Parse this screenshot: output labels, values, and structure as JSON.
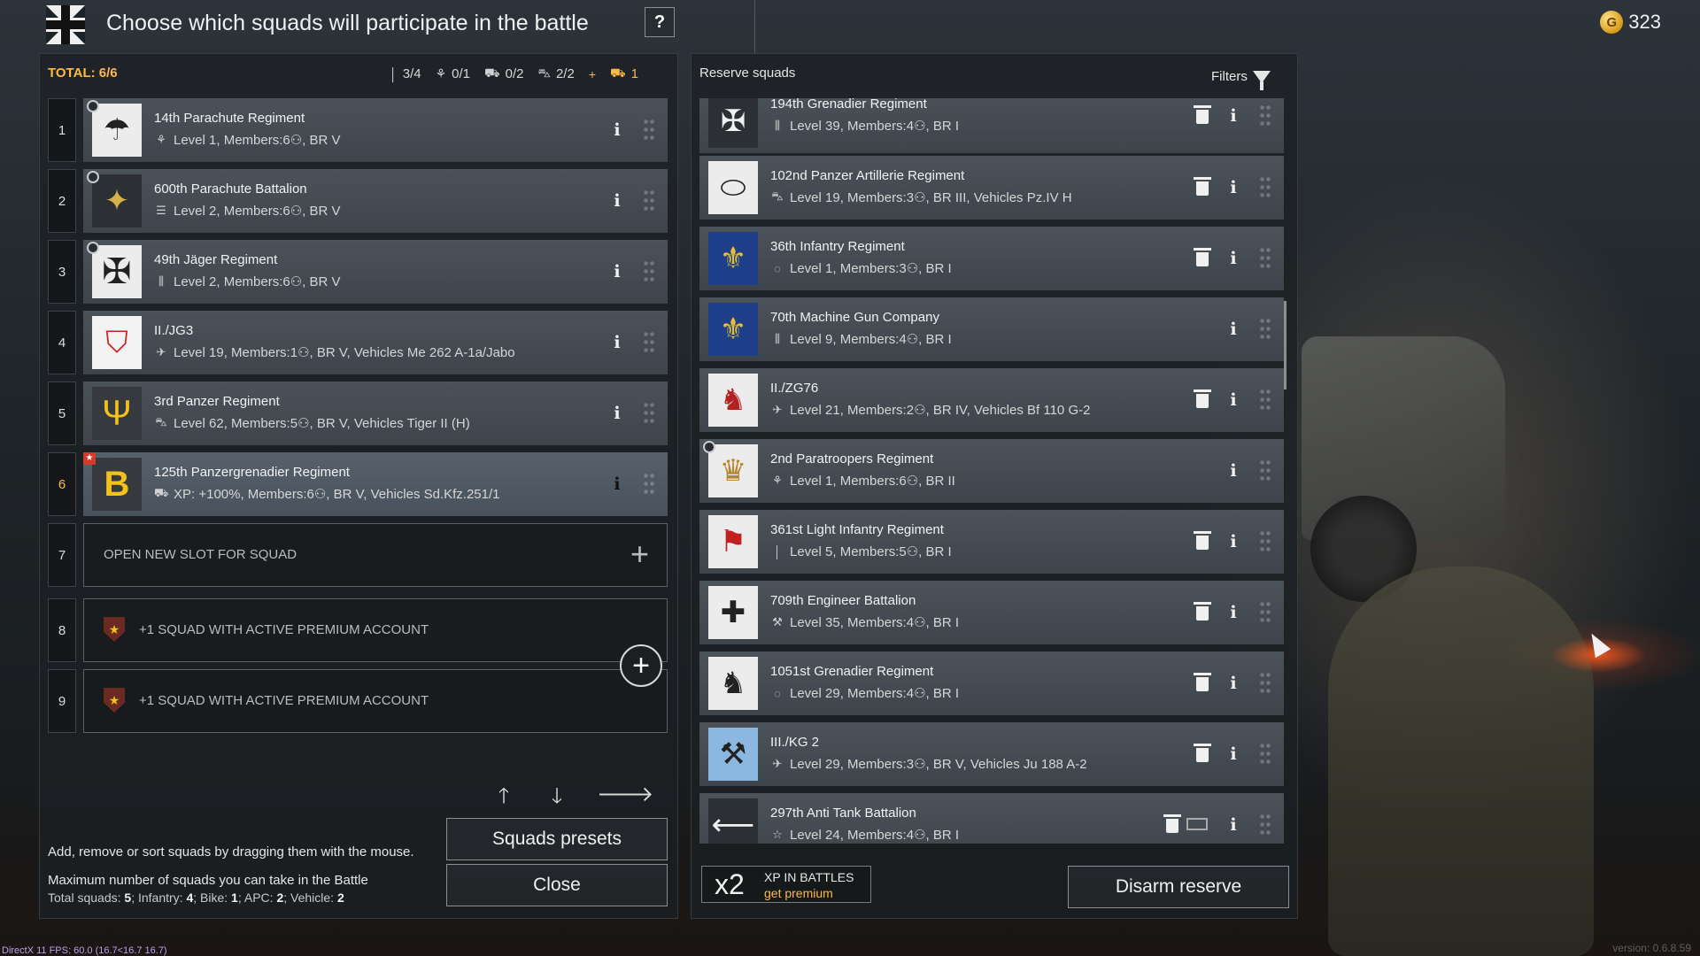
{
  "header": {
    "title": "Choose which squads will participate in the battle",
    "help_label": "?",
    "gold_symbol": "G",
    "gold_amount": "323"
  },
  "lineup": {
    "total_label": "TOTAL: 6/6",
    "counters": [
      {
        "icon": "infantry-icon",
        "glyph": "│",
        "value": "3/4"
      },
      {
        "icon": "paratrooper-icon",
        "glyph": "⚘",
        "value": "0/1"
      },
      {
        "icon": "vehicle-icon",
        "glyph": "⛟",
        "value": "0/2"
      },
      {
        "icon": "tank-icon",
        "glyph": "⛍",
        "value": "2/2"
      },
      {
        "icon": "plus-icon",
        "glyph": "+",
        "value": ""
      },
      {
        "icon": "premium-vehicle-icon",
        "glyph": "⛟",
        "value": "1"
      }
    ],
    "squads": [
      {
        "num": "1",
        "name": "14th Parachute Regiment",
        "type_glyph": "⚘",
        "info": "Level 1, Members:6⚇,  BR V"
      },
      {
        "num": "2",
        "name": "600th Parachute Battalion",
        "type_glyph": "☰",
        "info": "Level 2, Members:6⚇,  BR V"
      },
      {
        "num": "3",
        "name": "49th Jäger Regiment",
        "type_glyph": "⫼",
        "info": "Level 2, Members:6⚇,  BR V"
      },
      {
        "num": "4",
        "name": "II./JG3",
        "type_glyph": "✈",
        "info": "Level 19, Members:1⚇,  BR V,  Vehicles Me 262 A-1a/Jabo"
      },
      {
        "num": "5",
        "name": "3rd Panzer Regiment",
        "type_glyph": "⛍",
        "info": "Level 62, Members:5⚇,  BR V,  Vehicles Tiger II (H)"
      },
      {
        "num": "6",
        "name": "125th Panzergrenadier Regiment",
        "type_glyph": "⛟",
        "info": "XP: +100%, Members:6⚇,  BR V,  Vehicles Sd.Kfz.251/1"
      }
    ],
    "open_slot": {
      "num": "7",
      "label": "OPEN NEW SLOT FOR SQUAD"
    },
    "premium_slots": [
      {
        "num": "8",
        "label": "+1 SQUAD WITH ACTIVE PREMIUM ACCOUNT"
      },
      {
        "num": "9",
        "label": "+1 SQUAD WITH ACTIVE PREMIUM ACCOUNT"
      }
    ],
    "hint": "Add, remove or sort squads by dragging them with the mouse.",
    "max_title": "Maximum number of squads you can take in the Battle",
    "max_detail": {
      "total_label": "Total squads:",
      "total": "5",
      "infantry_label": "Infantry:",
      "infantry": "4",
      "bike_label": "Bike:",
      "bike": "1",
      "apc_label": "APC:",
      "apc": "2",
      "vehicle_label": "Vehicle:",
      "vehicle": "2"
    },
    "presets_label": "Squads presets",
    "close_label": "Close"
  },
  "reserve": {
    "title": "Reserve squads",
    "filters_label": "Filters",
    "squads": [
      {
        "name": "194th Grenadier Regiment",
        "type_glyph": "⫼",
        "info": "Level 39, Members:4⚇,  BR I",
        "emblem": "✠",
        "deletable": true
      },
      {
        "name": "102nd Panzer Artillerie Regiment",
        "type_glyph": "⛍",
        "info": "Level 19, Members:3⚇,  BR III,  Vehicles Pz.IV H",
        "emblem": "⬭",
        "deletable": true
      },
      {
        "name": "36th Infantry Regiment",
        "type_glyph": "◌",
        "info": "Level 1, Members:3⚇,  BR I",
        "emblem": "⚜",
        "deletable": true
      },
      {
        "name": "70th Machine Gun Company",
        "type_glyph": "⫼",
        "info": "Level 9, Members:4⚇,  BR I",
        "emblem": "⚜",
        "deletable": false
      },
      {
        "name": "II./ZG76",
        "type_glyph": "✈",
        "info": "Level 21, Members:2⚇,  BR IV,  Vehicles Bf 110 G-2",
        "emblem": "♞",
        "deletable": true
      },
      {
        "name": "2nd Paratroopers Regiment",
        "type_glyph": "⚘",
        "info": "Level 1, Members:6⚇,  BR II",
        "emblem": "♛",
        "deletable": false
      },
      {
        "name": "361st Light Infantry Regiment",
        "type_glyph": "│",
        "info": "Level 5, Members:5⚇,  BR I",
        "emblem": "⚑",
        "deletable": true
      },
      {
        "name": "709th Engineer Battalion",
        "type_glyph": "⚒",
        "info": "Level 35, Members:4⚇,  BR I",
        "emblem": "✚",
        "deletable": true
      },
      {
        "name": "1051st Grenadier Regiment",
        "type_glyph": "◌",
        "info": "Level 29, Members:4⚇,  BR I",
        "emblem": "♞",
        "deletable": true
      },
      {
        "name": "III./KG 2",
        "type_glyph": "✈",
        "info": "Level 29, Members:3⚇,  BR V,  Vehicles Ju 188 A-2",
        "emblem": "⚒",
        "deletable": true
      },
      {
        "name": "297th Anti Tank Battalion",
        "type_glyph": "☆",
        "info": "Level 24, Members:4⚇,  BR I",
        "emblem": "⟵",
        "deletable": true
      }
    ],
    "xp_multiplier": "x2",
    "xp_label": "XP IN BATTLES",
    "xp_link": "get premium",
    "disarm_label": "Disarm reserve"
  },
  "footer": {
    "debug": "DirectX 11 FPS: 60.0 (16.7<16.7 16.7)",
    "version": "version: 0.6.8.59"
  },
  "colors": {
    "accent": "#ffb84a",
    "panel": "#3e444b",
    "premium_red": "#d23a2a"
  }
}
